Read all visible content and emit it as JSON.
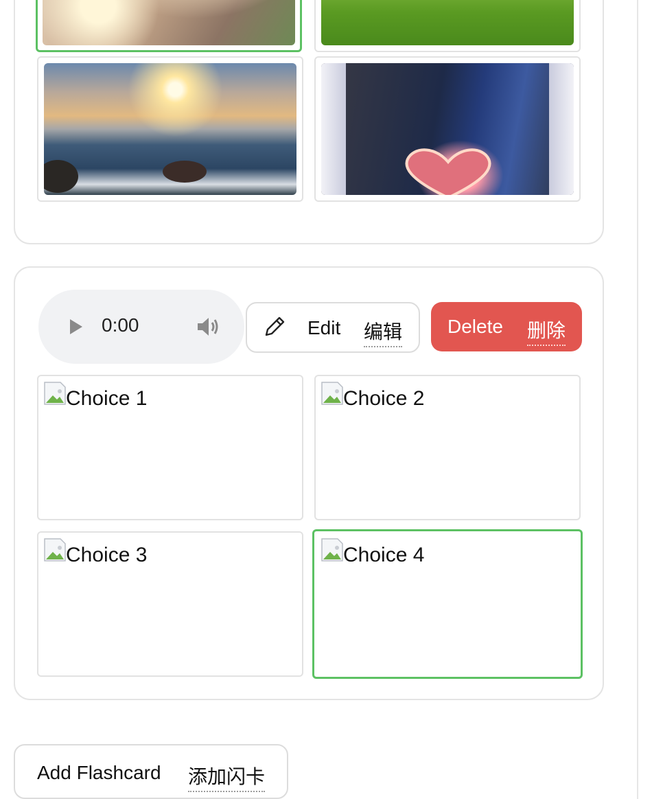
{
  "top_gallery": {
    "images": [
      {
        "icon": "cat-photo",
        "selected": true
      },
      {
        "icon": "green-field-photo",
        "selected": false
      },
      {
        "icon": "sea-sunset-photo",
        "selected": false
      },
      {
        "icon": "heart-beach-photo",
        "selected": false
      }
    ]
  },
  "flashcard": {
    "audio": {
      "time": "0:00",
      "play_icon": "play-icon",
      "volume_icon": "volume-icon"
    },
    "edit": {
      "label": "Edit",
      "label_zh": "编辑",
      "icon": "pencil-icon"
    },
    "delete": {
      "label": "Delete",
      "label_zh": "删除",
      "color": "#e25650"
    },
    "choices": [
      {
        "alt": "Choice 1",
        "selected": false
      },
      {
        "alt": "Choice 2",
        "selected": false
      },
      {
        "alt": "Choice 3",
        "selected": false
      },
      {
        "alt": "Choice 4",
        "selected": true
      }
    ],
    "selected_color": "#5cc163"
  },
  "add_flashcard": {
    "label": "Add Flashcard",
    "label_zh": "添加闪卡"
  }
}
